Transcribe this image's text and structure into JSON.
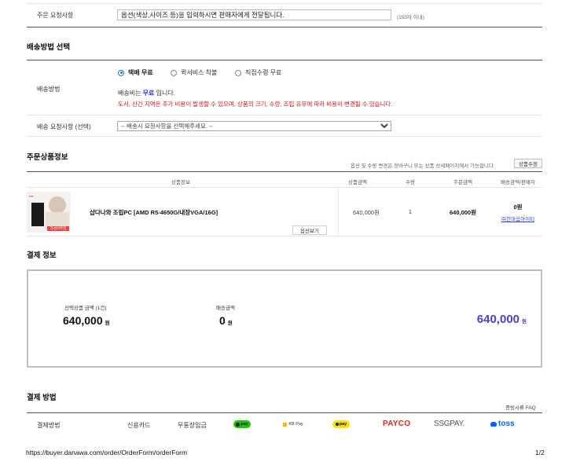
{
  "request": {
    "label": "주문 요청사항",
    "value": "옵션(색상,사이즈 등)을 입력하시면 판매자에게 전달됩니다.",
    "limit": "(150자 이내)"
  },
  "shipping": {
    "title": "배송방법 선택",
    "method_label": "배송방법",
    "options": [
      {
        "label": "택배 무료",
        "selected": true
      },
      {
        "label": "퀵서비스 착불",
        "selected": false
      },
      {
        "label": "직접수령 무료",
        "selected": false
      }
    ],
    "fee_prefix": "배송비는 ",
    "fee_free": "무료",
    "fee_suffix": " 입니다.",
    "notice": "도서, 산간 지역은 추가 비용이 발생할 수 있으며, 상품의 크기, 수량, 조립 유무에 따라 비용이 변경될 수 있습니다.",
    "request_label": "배송 요청사항 (선택)",
    "request_placeholder": "-- 배송시 요청사항을 선택해주세요. --"
  },
  "order_items": {
    "title": "주문상품정보",
    "notice": "옵션 및 수량 변경은 장바구니 또는 상품 상세페이지에서 가능합니다.",
    "button": "상품수정",
    "headers": [
      "상품정보",
      "상품금액",
      "수량",
      "주문금액",
      "배송금액/판매자"
    ],
    "items": [
      {
        "name": "샵다나와 조립PC [AMD R5-4650G/내장VGA/16G]",
        "thumb_badge": "가성비추천",
        "option_button": "옵션보기",
        "price": "640,000원",
        "qty": "1",
        "order_price": "640,000원",
        "shipping": "0원",
        "seller": "㈜한마음아이티"
      }
    ]
  },
  "payment_info": {
    "title": "결제 정보",
    "selected_label": "선택상품 금액 (1건)",
    "selected_amount": "640,000",
    "won": "원",
    "ship_label": "배송금액",
    "ship_amount": "0",
    "total": "640,000",
    "accent": "#4a3fd1"
  },
  "payment_method": {
    "title": "결제 방법",
    "receipt_faq": "증빙서류 FAQ",
    "label": "결제방법",
    "methods": [
      "신용카드",
      "무통장입금"
    ],
    "logos": [
      "pay",
      "KB Pay",
      "pay",
      "PAYCO",
      "SSGPAY.",
      "toss"
    ]
  },
  "footer": {
    "url": "https://buyer.danawa.com/order/OrderForm/orderForm",
    "page": "1/2"
  }
}
